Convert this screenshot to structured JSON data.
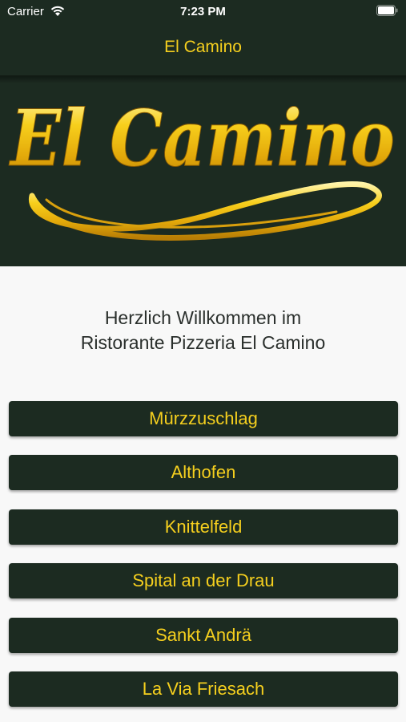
{
  "status_bar": {
    "carrier": "Carrier",
    "time": "7:23 PM"
  },
  "nav": {
    "title": "El Camino"
  },
  "banner": {
    "logo_text": "El Camino"
  },
  "welcome": {
    "line1": "Herzlich Willkommen im",
    "line2": "Ristorante Pizzeria El Camino"
  },
  "locations": [
    {
      "label": "Mürzzuschlag"
    },
    {
      "label": "Althofen"
    },
    {
      "label": "Knittelfeld"
    },
    {
      "label": "Spital an der Drau"
    },
    {
      "label": "Sankt Andrä"
    },
    {
      "label": "La Via Friesach"
    }
  ],
  "colors": {
    "primary": "#1c2b21",
    "accent": "#f5cf1e",
    "background": "#f8f8f8"
  }
}
